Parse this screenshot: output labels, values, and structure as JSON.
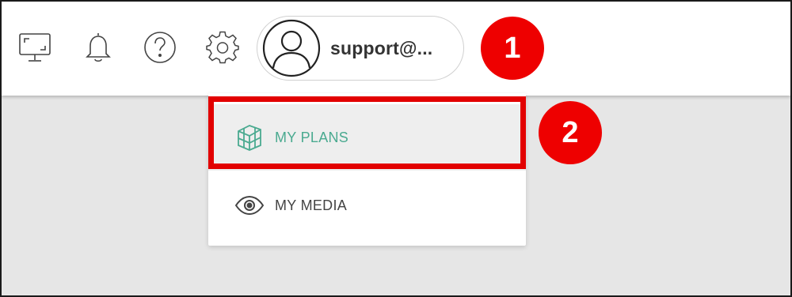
{
  "header": {
    "icons": [
      {
        "name": "monitor-icon"
      },
      {
        "name": "bell-icon"
      },
      {
        "name": "help-icon"
      },
      {
        "name": "gear-icon"
      }
    ],
    "account": {
      "label": "support@...",
      "avatar_icon": "user-avatar-icon"
    }
  },
  "dropdown": {
    "items": [
      {
        "label": "MY PLANS",
        "icon": "plans-icon",
        "color": "#4aaa90"
      },
      {
        "label": "MY MEDIA",
        "icon": "eye-icon",
        "color": "#444444"
      }
    ]
  },
  "annotations": {
    "step1": "1",
    "step2": "2",
    "highlight_color": "#e20000",
    "badge_color": "#ee0000"
  }
}
